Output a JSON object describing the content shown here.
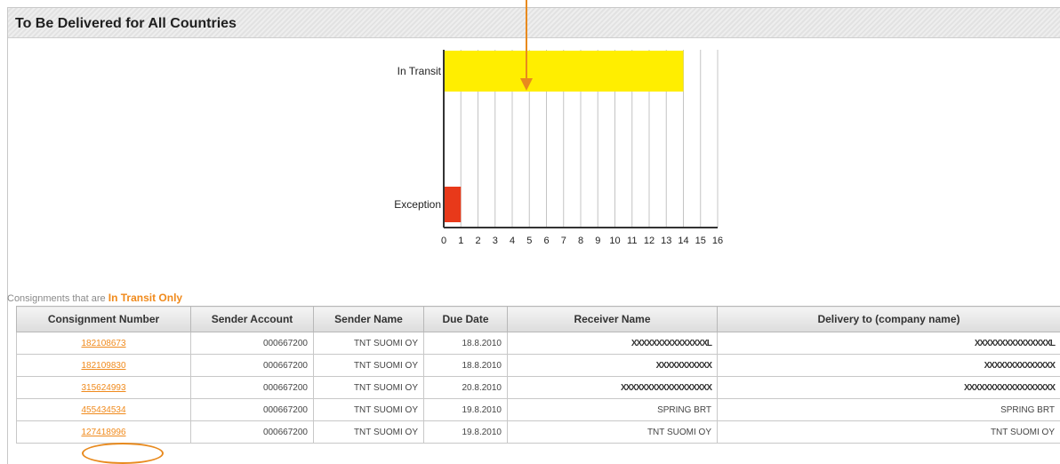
{
  "panel": {
    "title": "To Be Delivered for All Countries"
  },
  "chart_data": {
    "type": "bar",
    "orientation": "horizontal",
    "categories": [
      "In Transit",
      "Exception"
    ],
    "values": [
      14,
      1
    ],
    "colors": [
      "#ffee00",
      "#e8391a"
    ],
    "xlim": [
      0,
      16
    ],
    "xticks": [
      "0",
      "1",
      "2",
      "3",
      "4",
      "5",
      "6",
      "7",
      "8",
      "9",
      "10",
      "11",
      "12",
      "13",
      "14",
      "15",
      "16"
    ],
    "grid": true,
    "title": "",
    "xlabel": "",
    "ylabel": ""
  },
  "caption": {
    "prefix": "Consignments that are",
    "highlight": "In Transit Only"
  },
  "table": {
    "headers": [
      "Consignment Number",
      "Sender Account",
      "Sender Name",
      "Due Date",
      "Receiver Name",
      "Delivery to (company name)"
    ],
    "rows": [
      [
        "182108673",
        "000667200",
        "TNT SUOMI OY",
        "18.8.2010",
        "XXXXXXXXXXXXXXXL",
        "XXXXXXXXXXXXXXXL"
      ],
      [
        "182109830",
        "000667200",
        "TNT SUOMI OY",
        "18.8.2010",
        "XXXXXXXXXXX",
        "XXXXXXXXXXXXXX"
      ],
      [
        "315624993",
        "000667200",
        "TNT SUOMI OY",
        "20.8.2010",
        "XXXXXXXXXXXXXXXXXX",
        "XXXXXXXXXXXXXXXXXX"
      ],
      [
        "455434534",
        "000667200",
        "TNT SUOMI OY",
        "19.8.2010",
        "SPRING BRT",
        "SPRING BRT"
      ],
      [
        "127418996",
        "000667200",
        "TNT SUOMI OY",
        "19.8.2010",
        "TNT SUOMI OY",
        "TNT SUOMI OY"
      ]
    ]
  },
  "annotations": {
    "accent": "#e88a1e"
  }
}
